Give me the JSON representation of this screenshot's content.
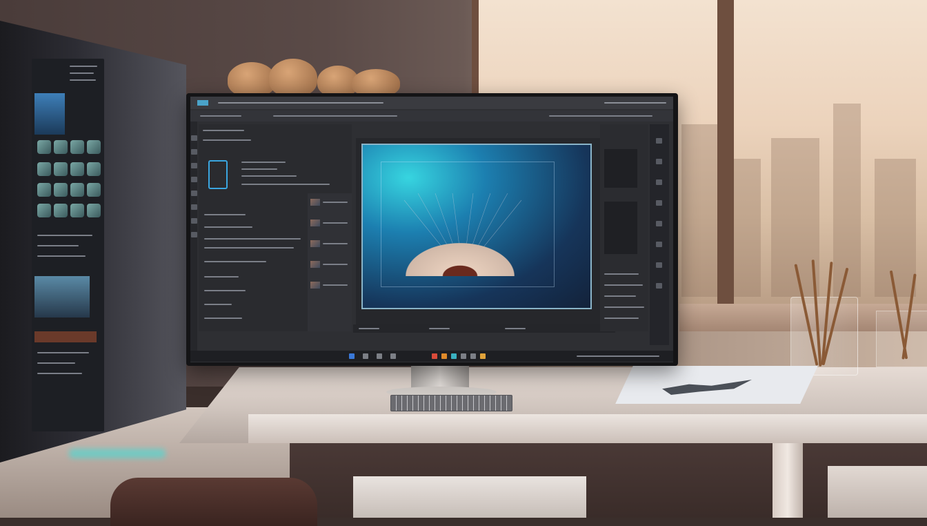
{
  "scene": {
    "subject": "monitor-with-photo-editor",
    "accent_colors": {
      "canvas_cyan": "#37d5e0",
      "canvas_blue": "#1c7fb0",
      "ui_dark": "#2e2f33",
      "window_light": "#f3e2d0"
    }
  },
  "screen_ui": {
    "window_title": "",
    "menu_items": [],
    "canvas": {
      "artwork": "fan-shell-on-blue-gradient"
    },
    "taskbar_icons": [
      "task-icon-blue",
      "task-icon-red",
      "task-icon-orange",
      "task-icon-teal",
      "task-icon-gray"
    ]
  },
  "tablet": {
    "icons": [
      "app-icon-1",
      "app-icon-2",
      "app-icon-3",
      "app-icon-4",
      "app-icon-5",
      "app-icon-6",
      "app-icon-7",
      "app-icon-8",
      "app-icon-9",
      "app-icon-10",
      "app-icon-11",
      "app-icon-12",
      "app-icon-13",
      "app-icon-14",
      "app-icon-15",
      "app-icon-16"
    ]
  }
}
